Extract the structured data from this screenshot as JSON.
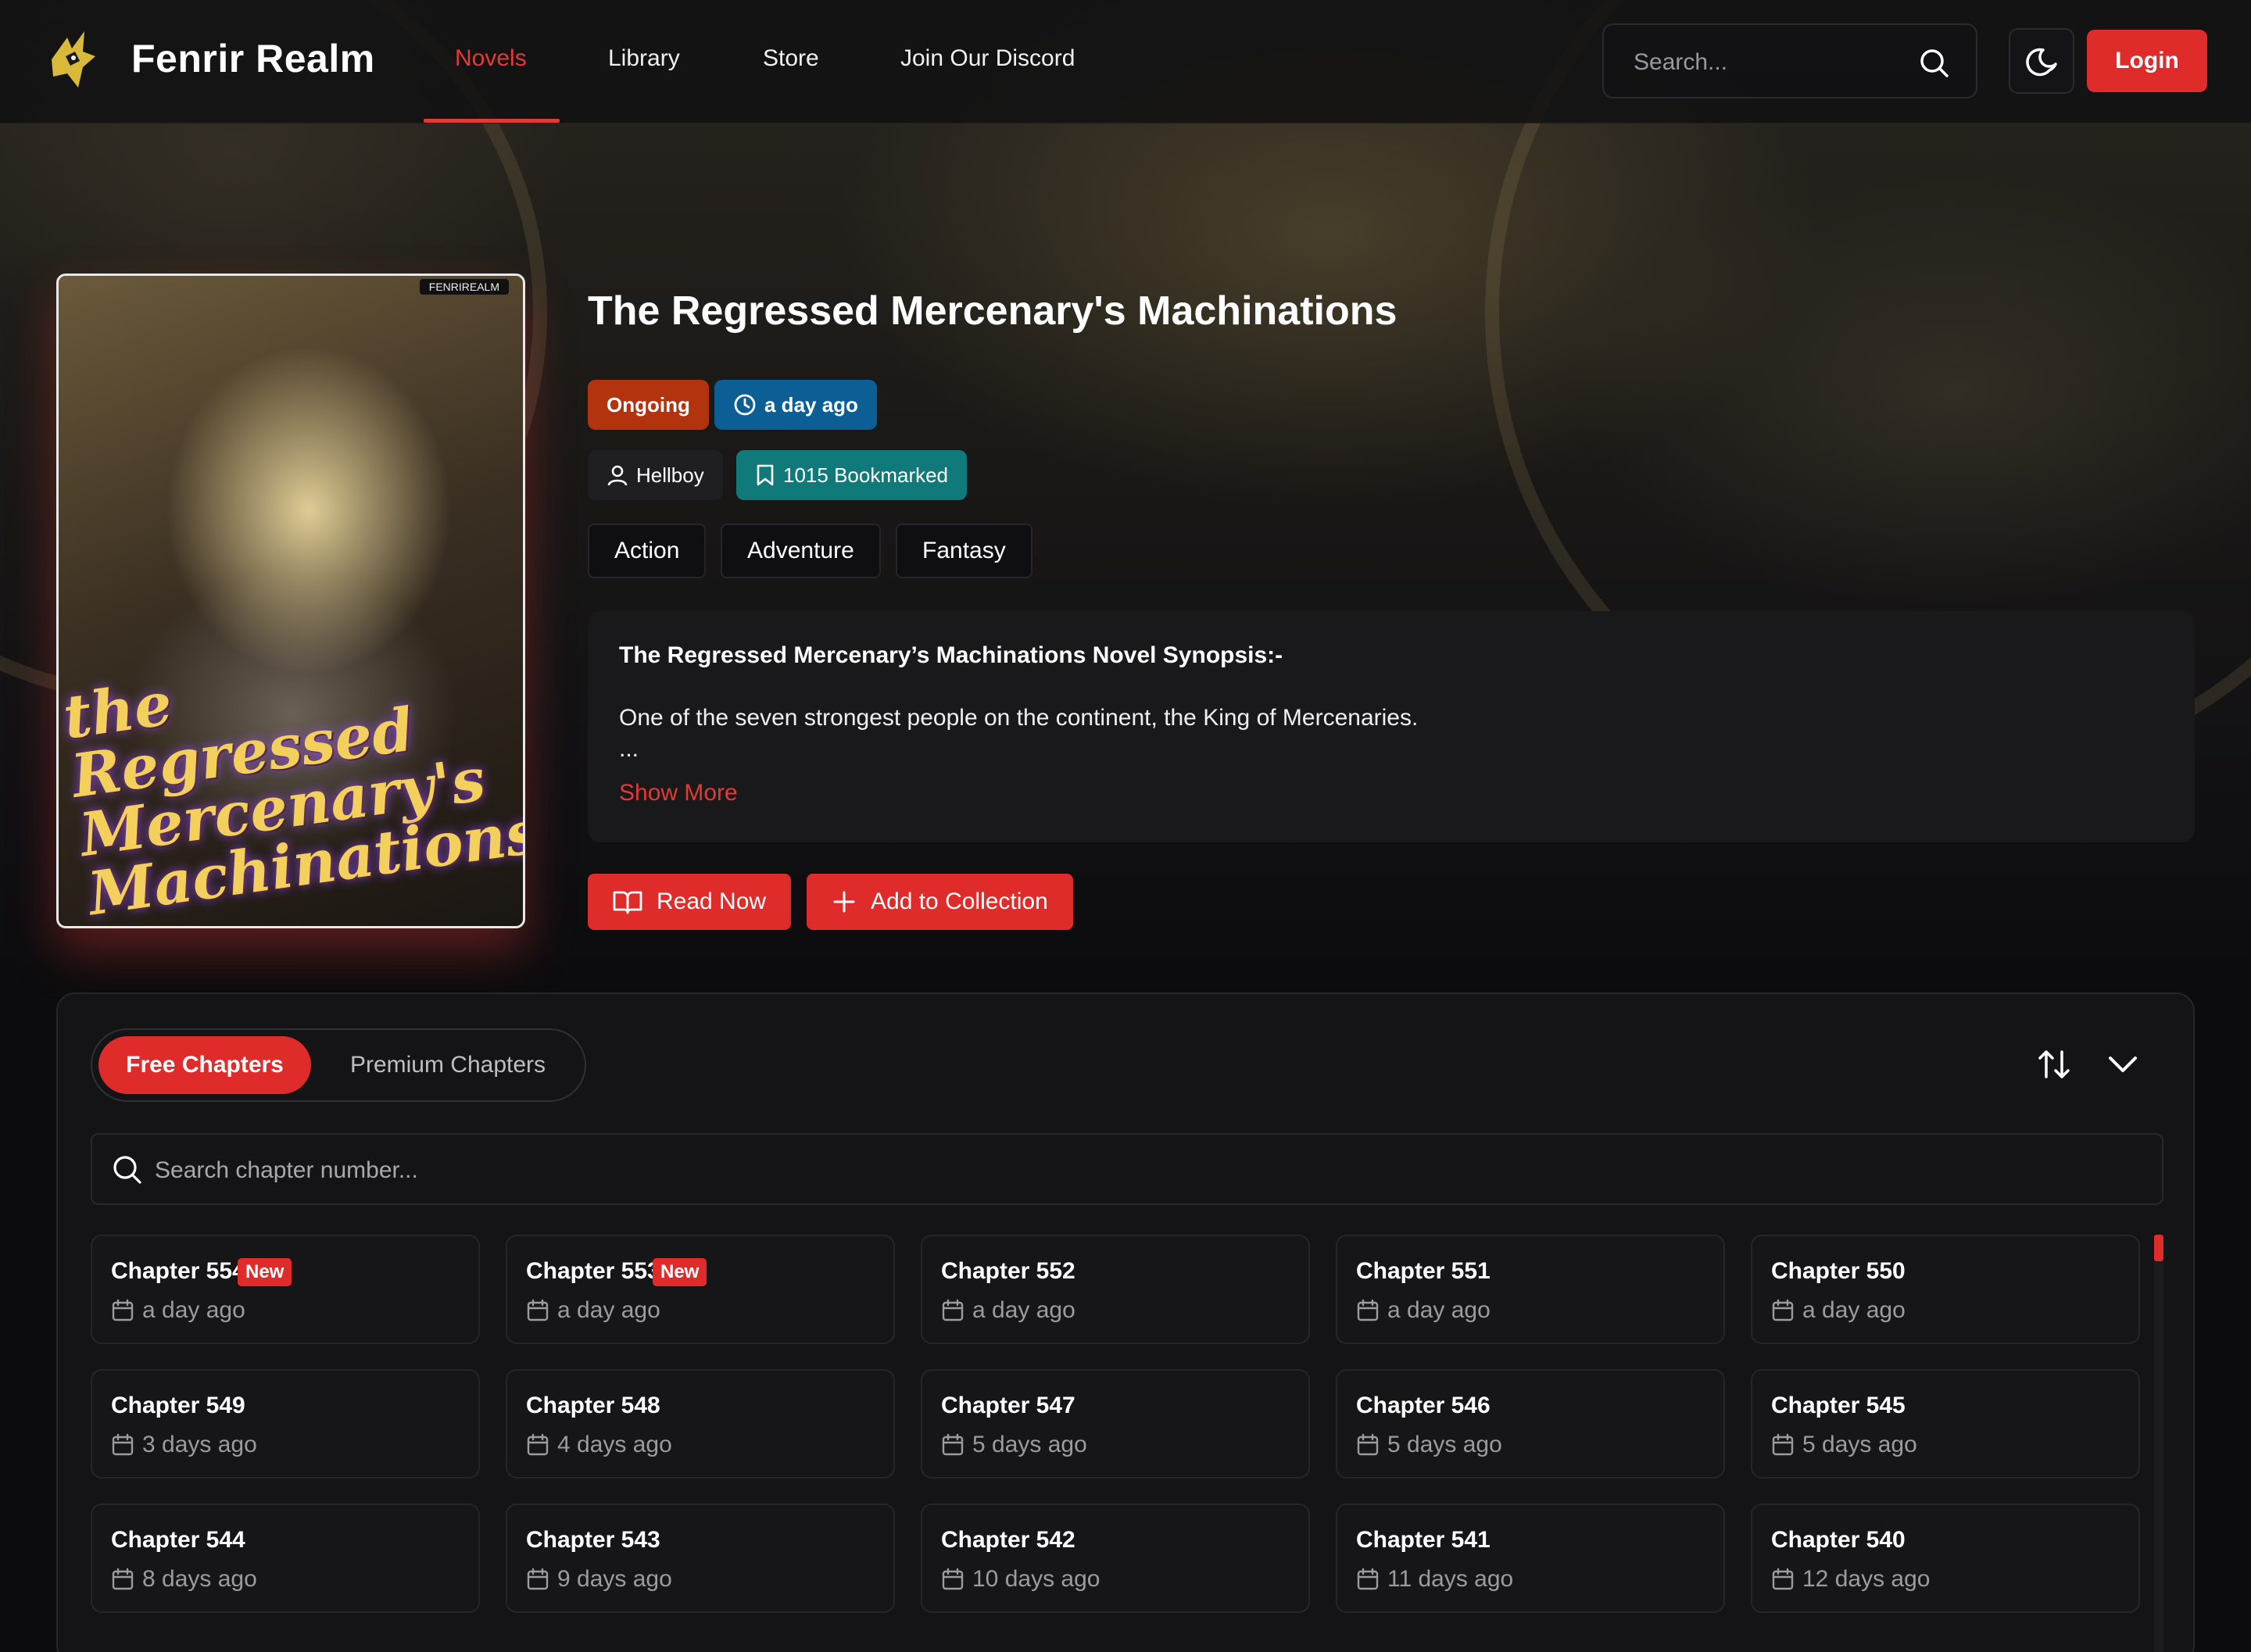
{
  "header": {
    "brand": "Fenrir Realm",
    "nav": [
      "Novels",
      "Library",
      "Store",
      "Join Our Discord"
    ],
    "active_nav": "Novels",
    "search_placeholder": "Search...",
    "login_label": "Login"
  },
  "novel": {
    "title": "The Regressed Mercenary's Machinations",
    "status": "Ongoing",
    "updated": "a day ago",
    "author": "Hellboy",
    "bookmarks": "1015 Bookmarked",
    "genres": [
      "Action",
      "Adventure",
      "Fantasy"
    ],
    "cover_text": "the Regressed Mercenary's Machinations",
    "cover_tag": "FENRIREALM"
  },
  "synopsis": {
    "heading": "The Regressed Mercenary’s Machinations Novel Synopsis:-",
    "text": "One of the seven strongest people on the continent, the King of Mercenaries.",
    "ellipsis": "...",
    "show_more": "Show More"
  },
  "actions": {
    "read_now": "Read Now",
    "add_collection": "Add to Collection"
  },
  "chapters": {
    "tabs": [
      "Free Chapters",
      "Premium Chapters"
    ],
    "active_tab": "Free Chapters",
    "search_placeholder": "Search chapter number...",
    "new_label": "New",
    "items": [
      {
        "name": "Chapter 554",
        "date": "a day ago",
        "new": true
      },
      {
        "name": "Chapter 553",
        "date": "a day ago",
        "new": true
      },
      {
        "name": "Chapter 552",
        "date": "a day ago",
        "new": false
      },
      {
        "name": "Chapter 551",
        "date": "a day ago",
        "new": false
      },
      {
        "name": "Chapter 550",
        "date": "a day ago",
        "new": false
      },
      {
        "name": "Chapter 549",
        "date": "3 days ago",
        "new": false
      },
      {
        "name": "Chapter 548",
        "date": "4 days ago",
        "new": false
      },
      {
        "name": "Chapter 547",
        "date": "5 days ago",
        "new": false
      },
      {
        "name": "Chapter 546",
        "date": "5 days ago",
        "new": false
      },
      {
        "name": "Chapter 545",
        "date": "5 days ago",
        "new": false
      },
      {
        "name": "Chapter 544",
        "date": "8 days ago",
        "new": false
      },
      {
        "name": "Chapter 543",
        "date": "9 days ago",
        "new": false
      },
      {
        "name": "Chapter 542",
        "date": "10 days ago",
        "new": false
      },
      {
        "name": "Chapter 541",
        "date": "11 days ago",
        "new": false
      },
      {
        "name": "Chapter 540",
        "date": "12 days ago",
        "new": false
      }
    ]
  },
  "colors": {
    "accent": "#e02b2b",
    "status_badge": "#b3330f",
    "time_badge": "#0c5f95",
    "bookmark_badge": "#107a7a",
    "background": "#0c0c0e"
  },
  "icons": [
    "wolf-logo-icon",
    "search-icon",
    "moon-icon",
    "clock-icon",
    "user-icon",
    "bookmark-icon",
    "book-open-icon",
    "plus-icon",
    "sort-icon",
    "chevron-down-icon",
    "calendar-icon"
  ]
}
